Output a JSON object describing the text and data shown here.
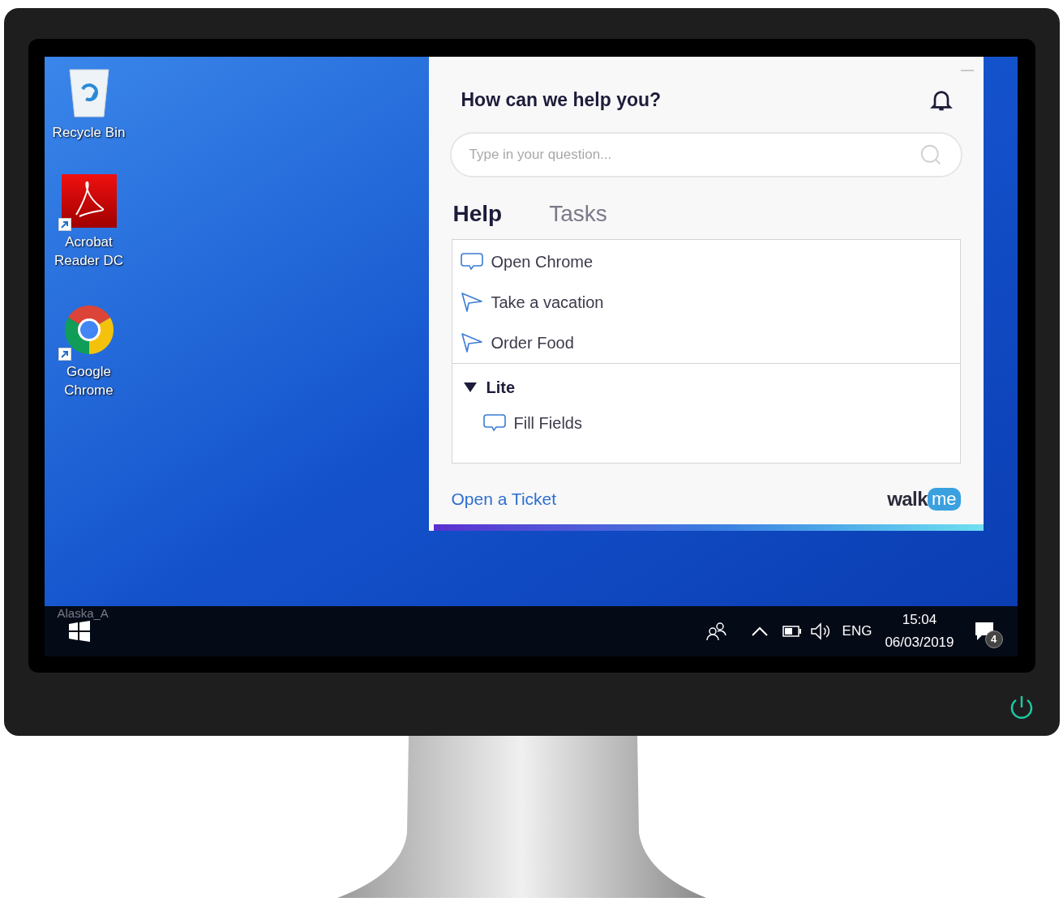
{
  "desktop_icons": [
    {
      "label": "Recycle Bin",
      "kind": "recycle",
      "shortcut": false
    },
    {
      "label": "Acrobat Reader DC",
      "kind": "acrobat",
      "shortcut": true
    },
    {
      "label": "Google Chrome",
      "kind": "chrome",
      "shortcut": true
    }
  ],
  "help_panel": {
    "title": "How can we help you?",
    "search": {
      "placeholder": "Type in your question..."
    },
    "tabs": [
      {
        "label": "Help",
        "selected": true
      },
      {
        "label": "Tasks",
        "selected": false
      }
    ],
    "items": [
      {
        "label": "Open Chrome",
        "kind": "chat"
      },
      {
        "label": "Take a vacation",
        "kind": "send"
      },
      {
        "label": "Order Food",
        "kind": "send"
      }
    ],
    "groups": [
      {
        "label": "Lite",
        "expanded": true,
        "children": [
          {
            "label": "Fill Fields",
            "kind": "chat"
          }
        ]
      }
    ],
    "footer_link": "Open a Ticket",
    "logo": {
      "first": "walk",
      "second": "me"
    }
  },
  "taskbar": {
    "faded_label": "Alaska_A",
    "language": "ENG",
    "time": "15:04",
    "date": "06/03/2019",
    "notification_count": "4"
  }
}
